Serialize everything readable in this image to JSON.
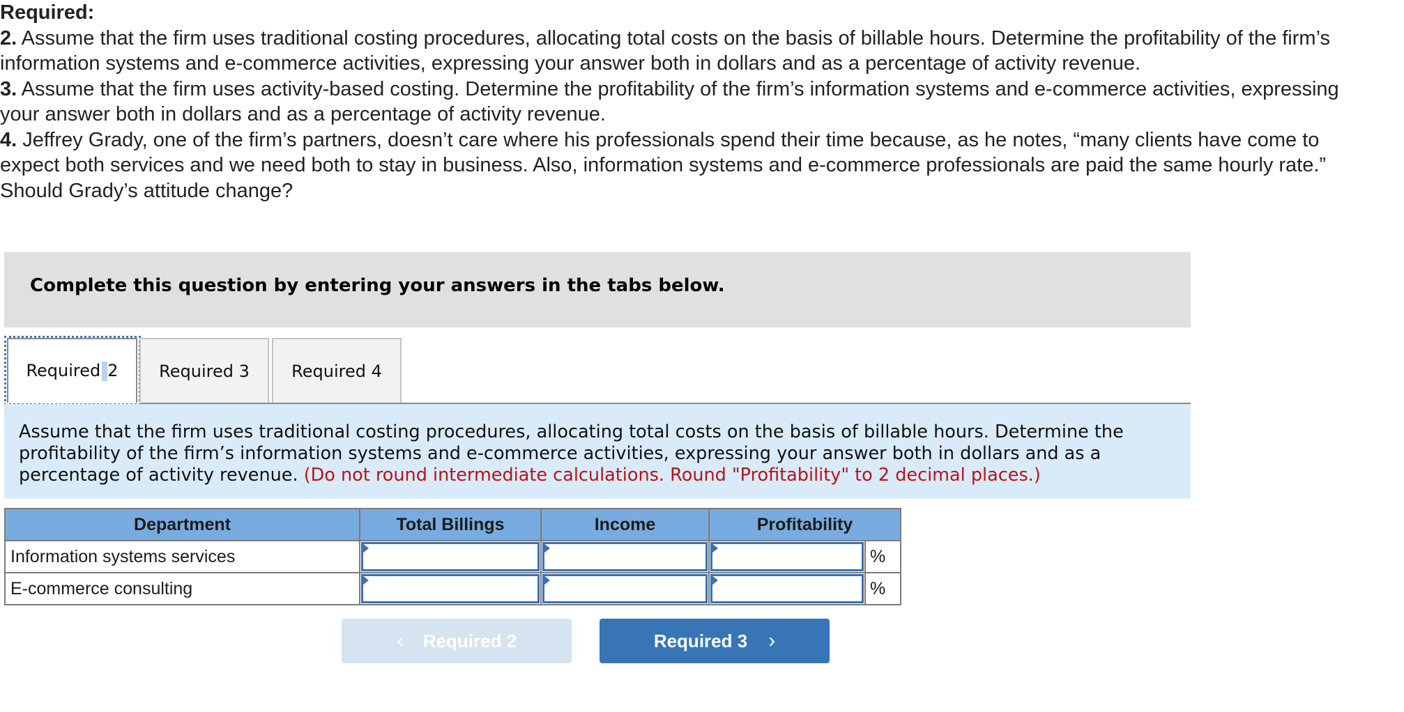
{
  "question": {
    "required_label": "Required:",
    "items": [
      {
        "num": "2.",
        "text": " Assume that the firm uses traditional costing procedures, allocating total costs on the basis of billable hours. Determine the profitability of the firm’s information systems and e-commerce activities, expressing your answer both in dollars and as a percentage of activity revenue."
      },
      {
        "num": "3.",
        "text": " Assume that the firm uses activity-based costing. Determine the profitability of the firm’s information systems and e-commerce activities, expressing your answer both in dollars and as a percentage of activity revenue."
      },
      {
        "num": "4.",
        "text": " Jeffrey Grady, one of the firm’s partners, doesn’t care where his professionals spend their time because, as he notes, “many clients have come to expect both services and we need both to stay in business. Also, information systems and e-commerce professionals are paid the same hourly rate.” Should Grady’s attitude change?"
      }
    ]
  },
  "banner": {
    "text": "Complete this question by entering your answers in the tabs below."
  },
  "tabs": [
    {
      "label_a": "Required",
      "label_b": "2",
      "active": true
    },
    {
      "label": "Required 3",
      "active": false
    },
    {
      "label": "Required 4",
      "active": false
    }
  ],
  "instructions": {
    "text": "Assume that the firm uses traditional costing procedures, allocating total costs on the basis of billable hours. Determine the profitability of the firm’s information systems and e-commerce activities, expressing your answer both in dollars and as a percentage of activity revenue. ",
    "note": "(Do not round intermediate calculations. Round \"Profitability\" to 2 decimal places.)"
  },
  "table": {
    "headers": [
      "Department",
      "Total Billings",
      "Income",
      "Profitability"
    ],
    "rows": [
      {
        "department": "Information systems services",
        "total_billings": "",
        "income": "",
        "profitability": "",
        "unit": "%"
      },
      {
        "department": "E-commerce consulting",
        "total_billings": "",
        "income": "",
        "profitability": "",
        "unit": "%"
      }
    ]
  },
  "nav": {
    "prev_label": "Required 2",
    "next_label": "Required 3",
    "prev_icon": "chevron-left-icon",
    "next_icon": "chevron-right-icon",
    "prev_glyph": "‹",
    "next_glyph": "›"
  },
  "colors": {
    "header_blue": "#78ace0",
    "panel_blue": "#d9ebf9",
    "button_blue": "#3775b6",
    "note_red": "#b8141a"
  }
}
